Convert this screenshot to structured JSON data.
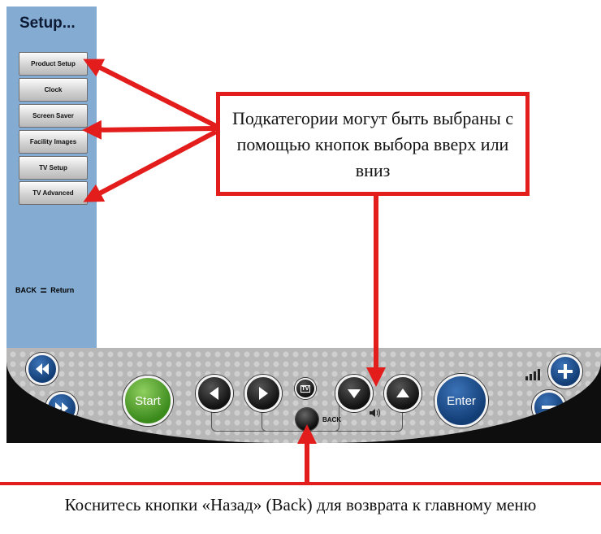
{
  "sidebar": {
    "title": "Setup...",
    "items": [
      {
        "label": "Product Setup"
      },
      {
        "label": "Clock"
      },
      {
        "label": "Screen Saver"
      },
      {
        "label": "Facility Images"
      },
      {
        "label": "TV Setup"
      },
      {
        "label": "TV Advanced"
      }
    ],
    "back_hint": {
      "left": "BACK",
      "eq": "=",
      "right": "Return"
    }
  },
  "remote": {
    "start_label": "Start",
    "enter_label": "Enter",
    "back_label": "BACK",
    "tv_label": "TV",
    "icons": [
      "rewind-icon",
      "fast-forward-icon",
      "left-arrow-icon",
      "right-arrow-icon",
      "down-arrow-icon",
      "up-arrow-icon",
      "speaker-icon",
      "signal-icon",
      "plus-icon",
      "minus-icon"
    ]
  },
  "annotations": {
    "callout": "Подкатегории могут быть выбраны с помощью кнопок выбора вверх или вниз",
    "footer": "Коснитесь кнопки «Назад» (Back) для возврата к главному меню"
  },
  "colors": {
    "accent_red": "#e31c1c",
    "sidebar_blue": "#84acd3",
    "button_blue": "#123d75",
    "start_green": "#3b8a1c"
  }
}
